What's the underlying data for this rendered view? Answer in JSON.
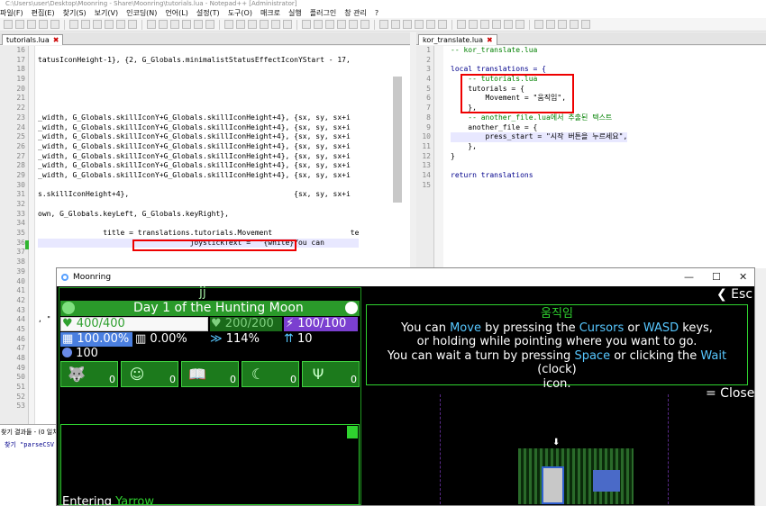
{
  "window_title": "C:\\Users\\user\\Desktop\\Moonring - Share\\Moonring\\tutorials.lua - Notepad++ [Administrator]",
  "menu": [
    "파일(F)",
    "편집(E)",
    "찾기(S)",
    "보기(V)",
    "인코딩(N)",
    "언어(L)",
    "설정(T)",
    "도구(O)",
    "매크로",
    "실행",
    "플러그인",
    "창 관리",
    "?"
  ],
  "left_tab": {
    "label": "tutorials.lua",
    "close": "✖"
  },
  "right_tab": {
    "label": "kor_translate.lua",
    "close": "✖"
  },
  "left_lines": {
    "numbers": [
      "16",
      "17",
      "18",
      "19",
      "20",
      "21",
      "22",
      "23",
      "24",
      "25",
      "26",
      "27",
      "28",
      "29",
      "30",
      "31",
      "32",
      "33",
      "34",
      "35",
      "36",
      "37",
      "38",
      "39",
      "40",
      "41",
      "42",
      "43",
      "44",
      "45",
      "46",
      "47",
      "48",
      "49",
      "50",
      "51",
      "52",
      "53"
    ],
    "code": [
      "",
      "tatusIconHeight-1}, {2, G_Globals.minimalistStatusEffectIconYStart - 17,",
      "",
      "",
      "",
      "",
      "",
      "_width, G_Globals.skillIconY+G_Globals.skillIconHeight+4}, {sx, sy, sx+i",
      "_width, G_Globals.skillIconY+G_Globals.skillIconHeight+4}, {sx, sy, sx+i",
      "_width, G_Globals.skillIconY+G_Globals.skillIconHeight+4}, {sx, sy, sx+i",
      "_width, G_Globals.skillIconY+G_Globals.skillIconHeight+4}, {sx, sy, sx+i",
      "_width, G_Globals.skillIconY+G_Globals.skillIconHeight+4}, {sx, sy, sx+i",
      "_width, G_Globals.skillIconY+G_Globals.skillIconHeight+4}, {sx, sy, sx+i",
      "_width, G_Globals.skillIconY+G_Globals.skillIconHeight+4}, {sx, sy, sx+i",
      "",
      "s.skillIconHeight+4},                                      {sx, sy, sx+i",
      "",
      "own, G_Globals.keyLeft, G_Globals.keyRight},",
      "",
      "               title = translations.tutorials.Movement                  te",
      "                                   joystickText =  \"{white}You can",
      "",
      "",
      "",
      "",
      "",
      "",
      "",
      ", \"",
      "",
      "",
      "",
      "",
      "",
      "",
      "",
      "",
      ""
    ]
  },
  "right_lines": {
    "numbers": [
      "1",
      "2",
      "3",
      "4",
      "5",
      "6",
      "7",
      "8",
      "9",
      "10",
      "11",
      "12",
      "13",
      "14",
      "15"
    ],
    "code": [
      "-- kor_translate.lua",
      "",
      "local translations = {",
      "    -- tutorials.lua",
      "    tutorials = {",
      "        Movement = \"움직임\",",
      "    },",
      "    -- another_file.lua에서 추출된 텍스트",
      "    another_file = {",
      "        press_start = \"시작 버튼을 누르세요\",",
      "    },",
      "}",
      "",
      "return translations",
      ""
    ]
  },
  "find_results": {
    "header": "찾기 결과들 - (0 일치",
    "line": "찾기 \"parseCSV"
  },
  "game": {
    "window_title": "Moonring",
    "min": "—",
    "max": "☐",
    "close": "✕",
    "player_name": "jj",
    "day_text": "Day 1 of the Hunting Moon",
    "hp": "400/400",
    "mp": "200/200",
    "ep": "100/100",
    "stat1": "100.00%",
    "stat2": "0.00%",
    "stat3": "114%",
    "stat4": "10",
    "gold": "100",
    "skills": [
      {
        "icon": "wolf-icon",
        "glyph": "🐺",
        "count": "0"
      },
      {
        "icon": "jester-icon",
        "glyph": "☺",
        "count": "0"
      },
      {
        "icon": "book-icon",
        "glyph": "📖",
        "count": "0"
      },
      {
        "icon": "crescent-icon",
        "glyph": "☾",
        "count": "0"
      },
      {
        "icon": "trident-icon",
        "glyph": "Ψ",
        "count": "0"
      }
    ],
    "esc": "❮ Esc",
    "tip_title": "움직임",
    "tip_l1_a": "You can ",
    "tip_l1_b": "Move",
    "tip_l1_c": " by pressing the ",
    "tip_l1_d": "Cursors",
    "tip_l1_e": " or ",
    "tip_l1_f": "WASD",
    "tip_l1_g": " keys,",
    "tip_l2": "or holding   while pointing where you want to go.",
    "tip_l3_a": "You can wait a turn by pressing ",
    "tip_l3_b": "Space",
    "tip_l3_c": " or clicking the ",
    "tip_l3_d": "Wait",
    "tip_l3_e": " (clock)",
    "tip_l4": "icon.",
    "close_tip": "= Close",
    "log_a": "Entering ",
    "log_b": "Yarrow",
    "colors": {
      "green": "#2fd32f",
      "blue": "#57c7ff",
      "gold": "#e8e840"
    }
  }
}
